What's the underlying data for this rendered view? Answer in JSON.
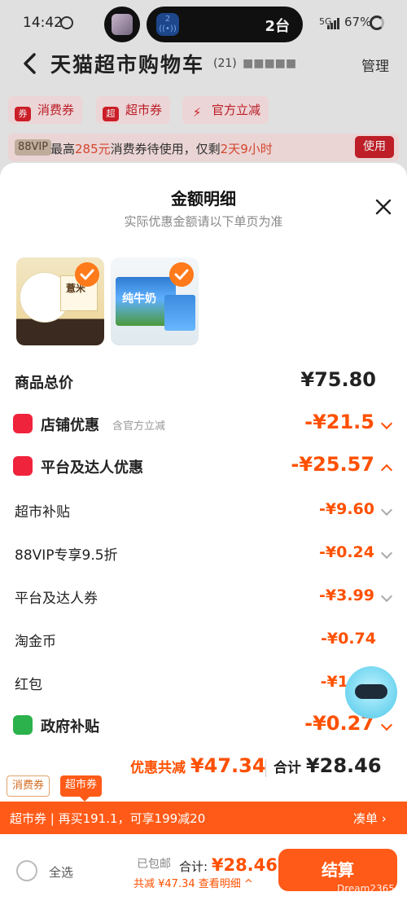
{
  "status_bar": {
    "time": "14:42",
    "island_count": "2台",
    "nfc_label": "2",
    "network": "5G",
    "battery": "67%"
  },
  "header": {
    "title": "天猫超市购物车",
    "count": "(21)",
    "address": "■■■■■",
    "manage": "管理"
  },
  "chips": [
    {
      "icon": "券",
      "label": "消费券"
    },
    {
      "icon": "超",
      "label": "超市券"
    },
    {
      "icon": "⚡",
      "label": "官方立减"
    }
  ],
  "vip_bar": {
    "badge": "88VIP",
    "text_before": "最高",
    "amount": "285元",
    "text_middle": "消费券待使用，仅剩",
    "time_left": "2天9小时",
    "button": "使用"
  },
  "sheet": {
    "title": "金额明细",
    "subtitle": "实际优惠金额请以下单页为准",
    "product1_caption": "薏米",
    "product2_caption": "纯牛奶",
    "rows": {
      "total": {
        "label": "商品总价",
        "value": "¥75.80"
      },
      "shop": {
        "label": "店铺优惠",
        "sub": "含官方立减",
        "value": "-¥21.5"
      },
      "platform": {
        "label": "平台及达人优惠",
        "value": "-¥25.57"
      },
      "supermarket": {
        "label": "超市补贴",
        "value": "-¥9.60"
      },
      "vip": {
        "label": "88VIP专享9.5折",
        "value": "-¥0.24"
      },
      "coupon": {
        "label": "平台及达人券",
        "value": "-¥3.99"
      },
      "coin": {
        "label": "淘金币",
        "value": "-¥0.74"
      },
      "redpack": {
        "label": "红包",
        "value": "-¥1"
      },
      "gov": {
        "label": "政府补贴",
        "value": "-¥0.27"
      }
    },
    "summary": {
      "discount_label": "优惠共减",
      "discount_value": "¥47.34",
      "total_label": "合计",
      "total_value": "¥28.46"
    }
  },
  "tags": {
    "consume": "消费券",
    "supermarket": "超市券"
  },
  "promo": {
    "text": "超市券 | 再买191.1，可享199减20",
    "action": "凑单 ›"
  },
  "bottom": {
    "select_all": "全选",
    "free_ship": "已包邮",
    "total_label": "合计:",
    "total_value": "¥28.46",
    "discount_line": "共减 ¥47.34 查看明细 ^",
    "checkout": "结算"
  },
  "watermark": "Dream2365",
  "colors": {
    "accent": "#ff5000",
    "red": "#c71f2a",
    "green": "#2bb24c"
  }
}
